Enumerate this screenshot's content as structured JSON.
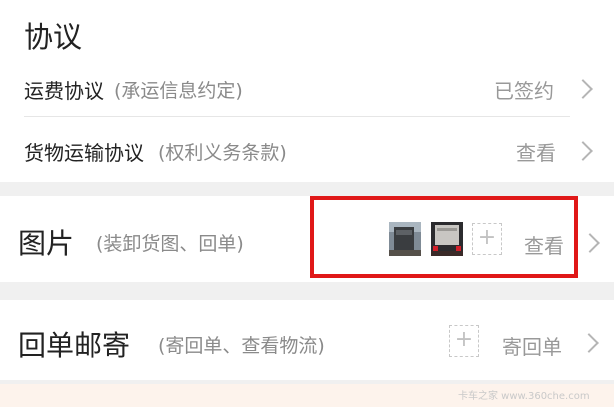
{
  "section_title": "协议",
  "agreements": [
    {
      "label": "运费协议",
      "sub": "(承运信息约定)",
      "action": "已签约"
    },
    {
      "label": "货物运输协议",
      "sub": "(权利义务条款)",
      "action": "查看"
    }
  ],
  "photos": {
    "label": "图片",
    "sub": "(装卸货图、回单)",
    "add": "+",
    "action": "查看",
    "thumbnails": [
      "truck-photo-1",
      "truck-photo-2"
    ]
  },
  "receipt_mail": {
    "label": "回单邮寄",
    "sub": "(寄回单、查看物流)",
    "add": "+",
    "action": "寄回单"
  },
  "watermark": "卡车之家 www.360che.com",
  "colors": {
    "highlight": "#e01818",
    "gray_text": "#999999",
    "sub_text": "#8a8a8a",
    "background": "#f0f0f0"
  }
}
